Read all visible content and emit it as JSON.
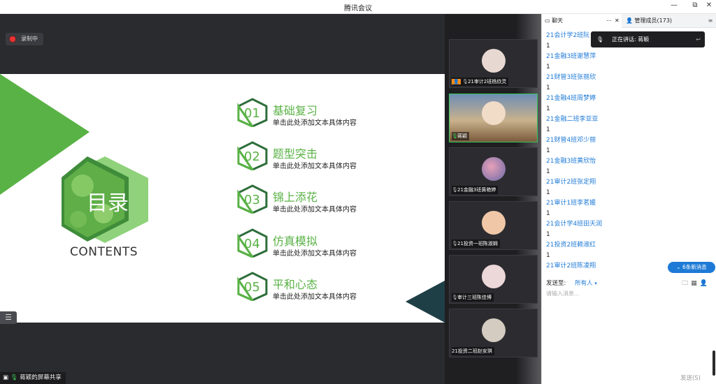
{
  "window": {
    "title": "腾讯会议"
  },
  "recording": {
    "label": "录制中"
  },
  "slide": {
    "center_label": "目录",
    "contents_label": "CONTENTS",
    "items": [
      {
        "num": "01",
        "title": "基础复习",
        "sub": "单击此处添加文本具体内容"
      },
      {
        "num": "02",
        "title": "题型突击",
        "sub": "单击此处添加文本具体内容"
      },
      {
        "num": "03",
        "title": "锦上添花",
        "sub": "单击此处添加文本具体内容"
      },
      {
        "num": "04",
        "title": "仿真模拟",
        "sub": "单击此处添加文本具体内容"
      },
      {
        "num": "05",
        "title": "平和心态",
        "sub": "单击此处添加文本具体内容"
      }
    ]
  },
  "share_bar": {
    "label": "蒋颖的屏幕共享"
  },
  "video_tiles": [
    {
      "name": "21审计2班杨欣灵",
      "avatar_color": "#e8d8d2"
    },
    {
      "name": "蒋颖",
      "avatar_color": "#8aa0c0"
    },
    {
      "name": "21金融3班黄艳婷",
      "avatar_color": "#8a7aa8"
    },
    {
      "name": "21投资一班陈淑娴",
      "avatar_color": "#e8c2a0"
    },
    {
      "name": "审计三班陈佳博",
      "avatar_color": "#e6d6d6"
    },
    {
      "name": "21投资二班赵安琪",
      "avatar_color": "#c8c0b4"
    }
  ],
  "chat": {
    "tab_chat": "聊天",
    "tab_members": "管理成员(173)",
    "speaking_label": "正在讲话: 蒋颖",
    "messages": [
      {
        "name": "21会计学2班阮",
        "text": "1"
      },
      {
        "name": "21金融3班谢慧萍",
        "text": "1"
      },
      {
        "name": "21财管3班张丽欣",
        "text": "1"
      },
      {
        "name": "21金融4班周梦婷",
        "text": "1"
      },
      {
        "name": "21金融二班李亚亚",
        "text": "1"
      },
      {
        "name": "21财管4班邓少丽",
        "text": "1"
      },
      {
        "name": "21金融3班黄欣怡",
        "text": "1"
      },
      {
        "name": "21审计2班张定翔",
        "text": "1"
      },
      {
        "name": "21审计1班李茗媛",
        "text": "1"
      },
      {
        "name": "21会计学4班田天润",
        "text": "1"
      },
      {
        "name": "21投资2班赖淑红",
        "text": "1"
      },
      {
        "name": "21审计2班陈凌翔",
        "text": ""
      }
    ],
    "new_messages": "6条新消息",
    "send_to_label": "发送至:",
    "send_to_value": "所有人",
    "input_placeholder": "请输入消息...",
    "send_button": "发送(S)"
  },
  "colors": {
    "accent_green": "#59b245",
    "dark_green": "#2d6e3a",
    "link_blue": "#1e7ad6"
  }
}
